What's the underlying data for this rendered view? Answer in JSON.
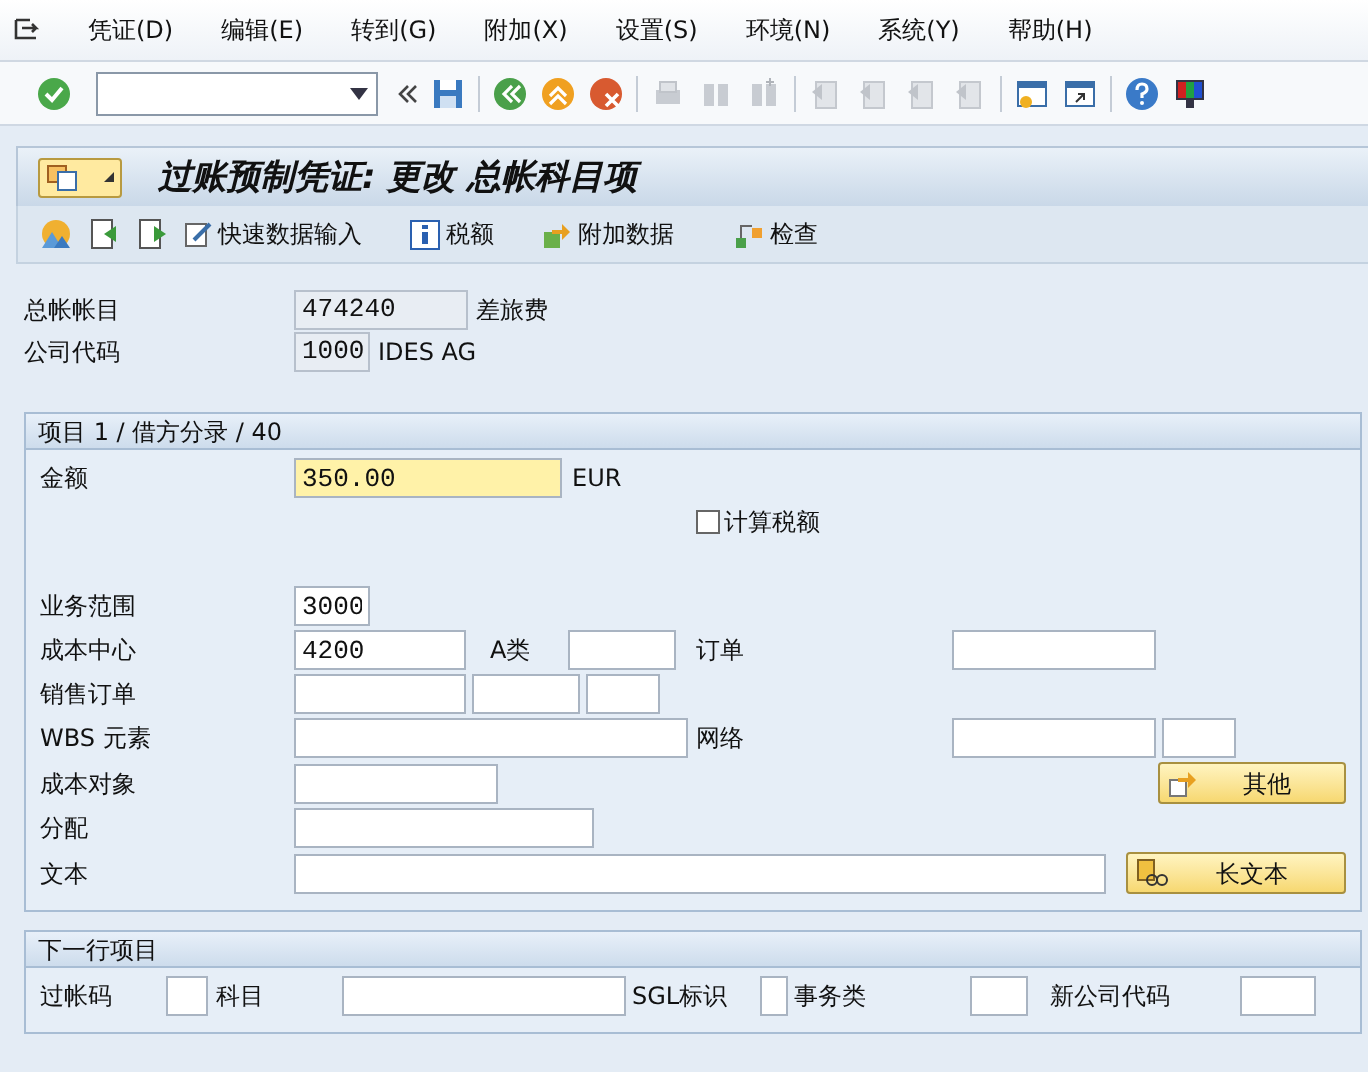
{
  "menu": [
    {
      "label": "凭证(D)"
    },
    {
      "label": "编辑(E)"
    },
    {
      "label": "转到(G)"
    },
    {
      "label": "附加(X)"
    },
    {
      "label": "设置(S)"
    },
    {
      "label": "环境(N)"
    },
    {
      "label": "系统(Y)"
    },
    {
      "label": "帮助(H)"
    }
  ],
  "title": "过账预制凭证: 更改 总帐科目项",
  "app_toolbar": [
    {
      "label": "快速数据输入"
    },
    {
      "label": "税额"
    },
    {
      "label": "附加数据"
    },
    {
      "label": "检查"
    }
  ],
  "header": {
    "gl_account": {
      "label": "总帐帐目",
      "value": "474240",
      "description": "差旅费"
    },
    "company_code": {
      "label": "公司代码",
      "value": "1000",
      "description": "IDES AG"
    }
  },
  "item": {
    "title": "项目 1 / 借方分录 / 40",
    "amount": {
      "label": "金额",
      "value": "350.00",
      "currency": "EUR"
    },
    "calc_tax": {
      "label": "计算税额",
      "checked": false
    },
    "business_area": {
      "label": "业务范围",
      "value": "3000"
    },
    "cost_center": {
      "label": "成本中心",
      "value": "4200"
    },
    "a_type": {
      "label": "A类"
    },
    "order": {
      "label": "订单"
    },
    "sales_order": {
      "label": "销售订单"
    },
    "wbs": {
      "label": "WBS 元素"
    },
    "network": {
      "label": "网络"
    },
    "cost_object": {
      "label": "成本对象"
    },
    "more_button": {
      "label": "其他"
    },
    "assignment": {
      "label": "分配"
    },
    "text": {
      "label": "文本"
    },
    "long_text_button": {
      "label": "长文本"
    }
  },
  "next_item": {
    "title": "下一行项目",
    "fields": [
      {
        "label": "过帐码"
      },
      {
        "label": "科目"
      },
      {
        "label": "SGL标识"
      },
      {
        "label": "事务类"
      },
      {
        "label": "新公司代码"
      }
    ]
  }
}
